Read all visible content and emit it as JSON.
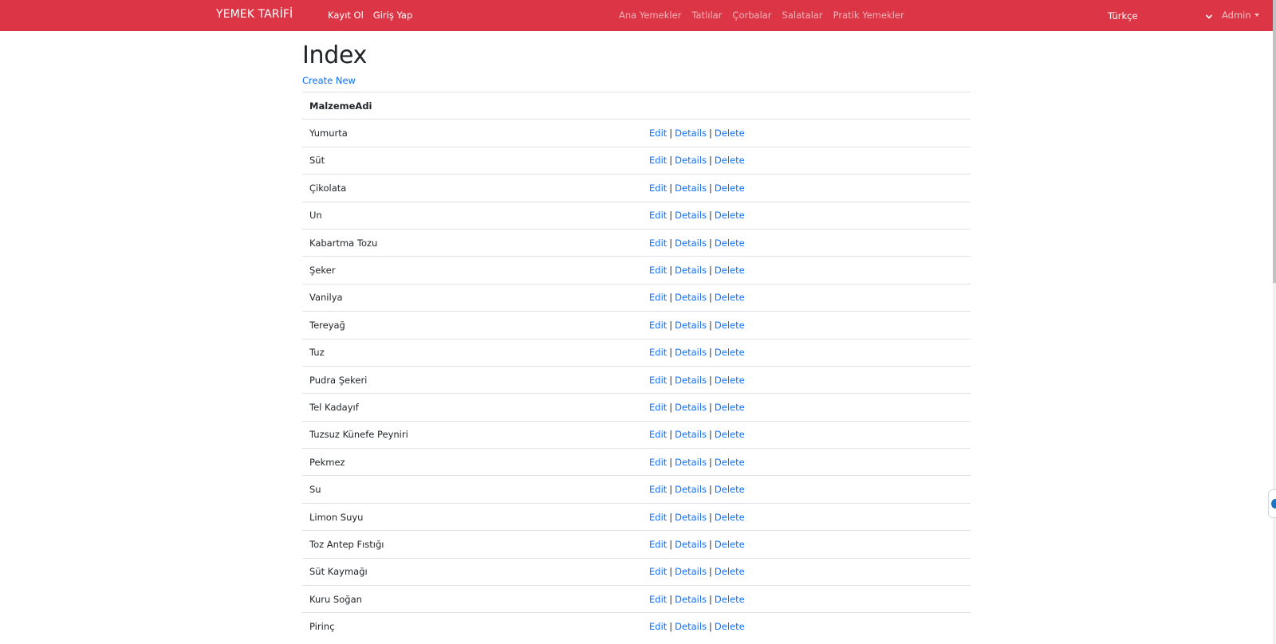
{
  "navbar": {
    "brand": "YEMEK TARİFİ",
    "auth_links": [
      "Kayıt Ol",
      "Giriş Yap"
    ],
    "category_links": [
      "Ana Yemekler",
      "Tatlılar",
      "Çorbalar",
      "Salatalar",
      "Pratik Yemekler"
    ],
    "language": "Türkçe",
    "user_menu": "Admin",
    "bg_color": "#dc3545"
  },
  "page": {
    "title": "Index",
    "create_link": "Create New"
  },
  "table": {
    "header": "MalzemeAdi",
    "actions": {
      "edit": "Edit",
      "details": "Details",
      "delete": "Delete",
      "separator": "|"
    },
    "rows": [
      "Yumurta",
      "Süt",
      "Çikolata",
      "Un",
      "Kabartma Tozu",
      "Şeker",
      "Vanilya",
      "Tereyağ",
      "Tuz",
      "Pudra Şekeri",
      "Tel Kadayıf",
      "Tuzsuz Künefe Peyniri",
      "Pekmez",
      "Su",
      "Limon Suyu",
      "Toz Antep Fıstığı",
      "Süt Kaymağı",
      "Kuru Soğan",
      "Pirinç"
    ]
  },
  "colors": {
    "link": "#0d6efd",
    "text": "#212529",
    "border": "#dee2e6"
  },
  "icons": {
    "language_dropdown": "chevron-down-icon",
    "user_menu": "caret-down-icon",
    "side_widget": "feedback-widget-icon"
  }
}
